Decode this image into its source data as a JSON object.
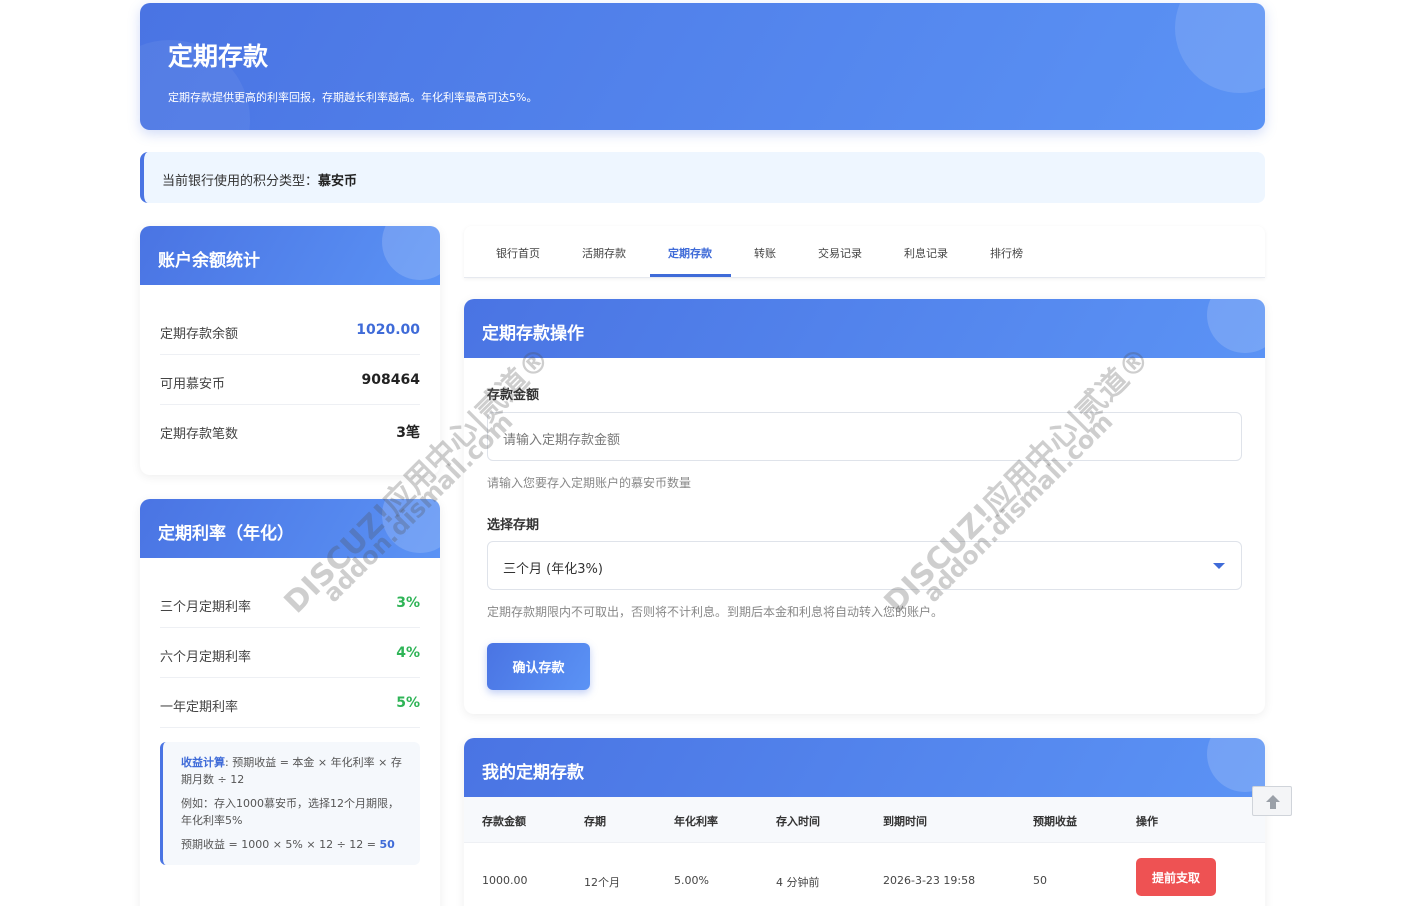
{
  "hero": {
    "title": "定期存款",
    "subtitle": "定期存款提供更高的利率回报，存期越长利率越高。年化利率最高可达5%。"
  },
  "notice": {
    "prefix": "当前银行使用的积分类型：",
    "currency": "慕安币"
  },
  "balance_card": {
    "title": "账户余额统计",
    "rows": [
      {
        "label": "定期存款余额",
        "value": "1020.00"
      },
      {
        "label": "可用慕安币",
        "value": "908464"
      },
      {
        "label": "定期存款笔数",
        "value": "3笔"
      }
    ]
  },
  "rate_card": {
    "title": "定期利率（年化）",
    "rows": [
      {
        "label": "三个月定期利率",
        "value": "3%"
      },
      {
        "label": "六个月定期利率",
        "value": "4%"
      },
      {
        "label": "一年定期利率",
        "value": "5%"
      }
    ],
    "calc": {
      "heading": "收益计算",
      "formula": ": 预期收益 = 本金 × 年化利率 × 存期月数 ÷ 12",
      "example": "例如：存入1000慕安币，选择12个月期限，年化利率5%",
      "result_prefix": "预期收益 = 1000 × 5% × 12 ÷ 12 = ",
      "result_value": "50"
    }
  },
  "tabs": [
    {
      "label": "银行首页"
    },
    {
      "label": "活期存款"
    },
    {
      "label": "定期存款"
    },
    {
      "label": "转账"
    },
    {
      "label": "交易记录"
    },
    {
      "label": "利息记录"
    },
    {
      "label": "排行榜"
    }
  ],
  "deposit_form": {
    "title": "定期存款操作",
    "amount_label": "存款金额",
    "amount_placeholder": "请输入定期存款金额",
    "amount_hint": "请输入您要存入定期账户的慕安币数量",
    "term_label": "选择存期",
    "term_selected": "三个月 (年化3%)",
    "term_hint": "定期存款期限内不可取出，否则将不计利息。到期后本金和利息将自动转入您的账户。",
    "submit_label": "确认存款"
  },
  "my_deposits": {
    "title": "我的定期存款",
    "columns": [
      "存款金额",
      "存期",
      "年化利率",
      "存入时间",
      "到期时间",
      "预期收益",
      "操作"
    ],
    "rows": [
      {
        "amount": "1000.00",
        "term": "12个月",
        "rate": "5.00%",
        "deposit_time": "4 分钟前",
        "maturity": "2026-3-23 19:58",
        "yield": "50",
        "action": "提前支取"
      }
    ]
  },
  "watermark": {
    "line1": "DISCUZ!应用中心|贰道®",
    "line2": "addon.dismall.com"
  },
  "colors": {
    "primary": "#4a74e3",
    "primary_light": "#5b93f5",
    "green": "#2fb457",
    "danger": "#ee5253"
  }
}
